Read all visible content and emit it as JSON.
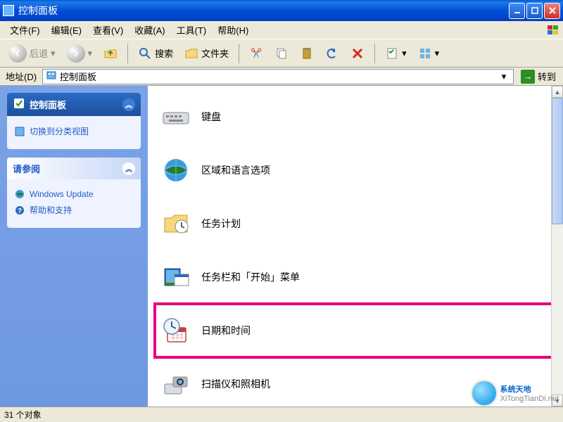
{
  "window": {
    "title": "控制面板"
  },
  "menu": {
    "file": "文件(F)",
    "edit": "编辑(E)",
    "view": "查看(V)",
    "favorites": "收藏(A)",
    "tools": "工具(T)",
    "help": "帮助(H)"
  },
  "toolbar": {
    "back": "后退",
    "search": "搜索",
    "folders": "文件夹"
  },
  "address": {
    "label": "地址(D)",
    "value": "控制面板",
    "go": "转到"
  },
  "sidebar": {
    "main": {
      "title": "控制面板",
      "switch_view": "切换到分类视图"
    },
    "see_also": {
      "title": "请参阅",
      "windows_update": "Windows Update",
      "help_support": "帮助和支持"
    }
  },
  "items": {
    "keyboard": "键盘",
    "regional": "区域和语言选项",
    "scheduled_tasks": "任务计划",
    "taskbar": "任务栏和「开始」菜单",
    "datetime": "日期和时间",
    "scanners": "扫描仪和照相机"
  },
  "status": {
    "text": "31 个对象"
  },
  "watermark": {
    "name": "系统天地",
    "url": "XiTongTianDi.net"
  }
}
